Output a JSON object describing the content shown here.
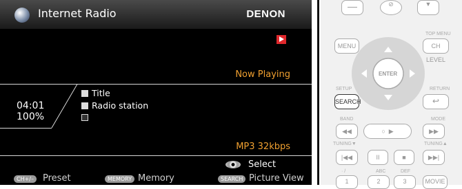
{
  "screen": {
    "title": "Internet Radio",
    "brand": "DENON",
    "status": "Now Playing",
    "time": "04:01",
    "progress": "100%",
    "info_lines": [
      "Title",
      "Radio station",
      ""
    ],
    "bitrate": "MP3 32kbps",
    "select_label": "Select",
    "footer": {
      "preset_key": "CH+/–",
      "preset_label": "Preset",
      "memory_key": "MEMORY",
      "memory_label": "Memory",
      "search_key": "SEARCH",
      "search_label": "Picture View"
    }
  },
  "remote": {
    "menu": "MENU",
    "ch_level": "CH LEVEL",
    "top_menu": "TOP MENU",
    "enter": "ENTER",
    "setup": "SETUP",
    "return": "RETURN",
    "search": "SEARCH",
    "band": "BAND",
    "mode": "MODE",
    "tuning_down": "TUNING▼",
    "tuning_up": "TUNING▲",
    "key1_label": "· /",
    "key2_label": "ABC",
    "key3_label": "DEF",
    "key1": "1",
    "key2": "2",
    "key3": "3",
    "movie": "MOVIE"
  },
  "colors": {
    "accent_orange": "#f0a030",
    "red_indicator": "#e0282c",
    "background": "#000000"
  },
  "icons": [
    "globe-icon",
    "play-indicator-icon",
    "note-icon",
    "station-icon",
    "album-art-icon",
    "select-wheel-icon"
  ]
}
